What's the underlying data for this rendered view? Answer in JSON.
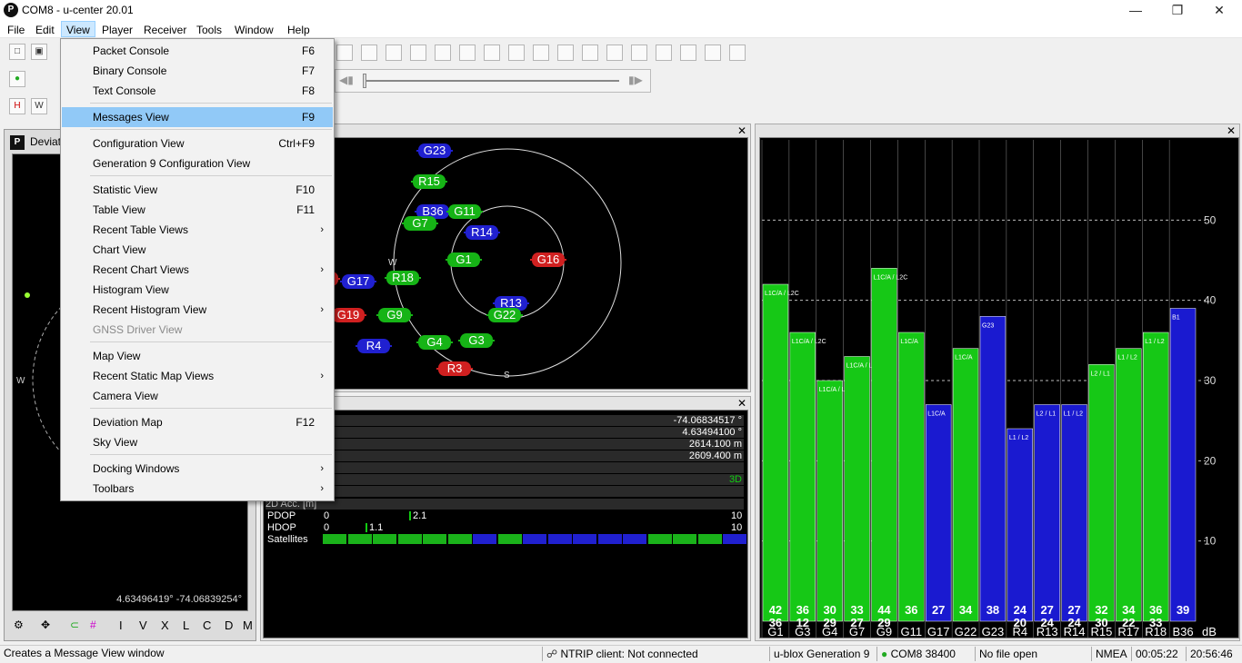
{
  "window": {
    "title": "COM8 - u-center 20.01",
    "app_icon": "P"
  },
  "menubar": [
    "File",
    "Edit",
    "View",
    "Player",
    "Receiver",
    "Tools",
    "Window",
    "Help"
  ],
  "view_menu": {
    "items": [
      {
        "label": "Packet Console",
        "shortcut": "F6"
      },
      {
        "label": "Binary Console",
        "shortcut": "F7"
      },
      {
        "label": "Text Console",
        "shortcut": "F8"
      },
      {
        "label": "Messages View",
        "shortcut": "F9"
      },
      {
        "label": "Configuration View",
        "shortcut": "Ctrl+F9"
      },
      {
        "label": "Generation 9 Configuration View",
        "shortcut": ""
      },
      {
        "label": "Statistic View",
        "shortcut": "F10"
      },
      {
        "label": "Table View",
        "shortcut": "F11"
      },
      {
        "label": "Recent Table Views",
        "shortcut": ""
      },
      {
        "label": "Chart View",
        "shortcut": ""
      },
      {
        "label": "Recent Chart Views",
        "shortcut": ""
      },
      {
        "label": "Histogram View",
        "shortcut": ""
      },
      {
        "label": "Recent Histogram View",
        "shortcut": ""
      },
      {
        "label": "GNSS Driver View",
        "shortcut": ""
      },
      {
        "label": "Map View",
        "shortcut": ""
      },
      {
        "label": "Recent Static Map Views",
        "shortcut": ""
      },
      {
        "label": "Camera View",
        "shortcut": ""
      },
      {
        "label": "Deviation Map",
        "shortcut": "F12"
      },
      {
        "label": "Sky View",
        "shortcut": ""
      },
      {
        "label": "Docking Windows",
        "shortcut": ""
      },
      {
        "label": "Toolbars",
        "shortcut": ""
      }
    ],
    "highlighted": "Messages View",
    "disabled": "GNSS Driver View"
  },
  "deviation_panel": {
    "title": "Deviat",
    "coords": "4.63496419° -74.06839254°",
    "compass_w": "W"
  },
  "deviation_toolbar": [
    "I",
    "V",
    "X",
    "L",
    "C",
    "D",
    "M"
  ],
  "sky_view": {
    "compass": {
      "w": "W",
      "s": "S"
    },
    "satellites": [
      {
        "id": "G23",
        "color": "blue"
      },
      {
        "id": "R15",
        "color": "green"
      },
      {
        "id": "B36",
        "color": "blue"
      },
      {
        "id": "G11",
        "color": "green"
      },
      {
        "id": "G7",
        "color": "green"
      },
      {
        "id": "R14",
        "color": "blue"
      },
      {
        "id": "G1",
        "color": "green"
      },
      {
        "id": "G16",
        "color": "red"
      },
      {
        "id": "R5",
        "color": "red"
      },
      {
        "id": "G17",
        "color": "blue"
      },
      {
        "id": "R18",
        "color": "green"
      },
      {
        "id": "R13",
        "color": "blue"
      },
      {
        "id": "G19",
        "color": "red"
      },
      {
        "id": "G9",
        "color": "green"
      },
      {
        "id": "G22",
        "color": "green"
      },
      {
        "id": "R4",
        "color": "blue"
      },
      {
        "id": "G4",
        "color": "green"
      },
      {
        "id": "G3",
        "color": "green"
      },
      {
        "id": "R3",
        "color": "red"
      }
    ]
  },
  "data_view": {
    "values": [
      "-74.06834517 °",
      "4.63494100 °",
      "2614.100 m",
      "2609.400 m",
      "3D"
    ],
    "acc_label": "2D Acc. [m]",
    "pdop": {
      "label": "PDOP",
      "min": "0",
      "value": "2.1",
      "max": "10"
    },
    "hdop": {
      "label": "HDOP",
      "min": "0",
      "value": "1.1",
      "max": "10"
    },
    "satellites_label": "Satellites",
    "sat_colors": [
      "#1ab21a",
      "#1ab21a",
      "#1ab21a",
      "#1ab21a",
      "#1ab21a",
      "#1ab21a",
      "#2020d0",
      "#1ab21a",
      "#2020d0",
      "#2020d0",
      "#2020d0",
      "#2020d0",
      "#2020d0",
      "#1ab21a",
      "#1ab21a",
      "#1ab21a",
      "#2020d0"
    ]
  },
  "chart_data": {
    "type": "bar",
    "ylabel": "dB",
    "ylim": [
      0,
      60
    ],
    "yticks": [
      10,
      20,
      30,
      40,
      50
    ],
    "categories": [
      "G1",
      "G3",
      "G4",
      "G7",
      "G9",
      "G11",
      "G17",
      "G22",
      "G23",
      "R4",
      "R13",
      "R14",
      "R15",
      "R17",
      "R18",
      "B36"
    ],
    "values_top": [
      42,
      36,
      30,
      33,
      44,
      36,
      27,
      34,
      38,
      24,
      27,
      27,
      32,
      34,
      36,
      39
    ],
    "values_bottom": [
      "36",
      "12",
      "29",
      "27",
      "29",
      "",
      "",
      "",
      "",
      "20",
      "24",
      "24",
      "30",
      "22",
      "33",
      ""
    ],
    "colors": [
      "green",
      "green",
      "green",
      "green",
      "green",
      "green",
      "blue",
      "green",
      "blue",
      "blue",
      "blue",
      "blue",
      "green",
      "green",
      "green",
      "blue"
    ],
    "band_labels": [
      "L1C/A / L2C",
      "L1C/A / L2C",
      "L1C/A / L2C",
      "L1C/A / L2C",
      "L1C/A / L2C",
      "L1C/A",
      "L1C/A",
      "L1C/A",
      "G23",
      "L1 / L2",
      "L2 / L1",
      "L1 / L2",
      "L2 / L1",
      "L1 / L2",
      "L1 / L2",
      "B1"
    ]
  },
  "statusbar": {
    "message": "Creates a Message View window",
    "ntrip": "NTRIP client: Not connected",
    "generation": "u-blox Generation 9",
    "port": "COM8 38400",
    "file": "No file open",
    "protocol": "NMEA",
    "elapsed": "00:05:22",
    "clock": "20:56:46"
  }
}
